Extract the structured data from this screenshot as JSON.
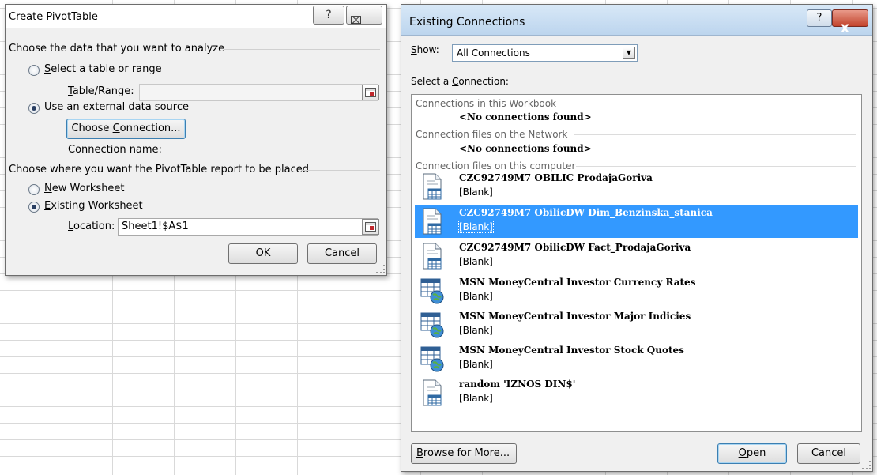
{
  "pivot": {
    "title": "Create PivotTable",
    "help": "?",
    "close": "X",
    "group1": "Choose the data that you want to analyze",
    "opt_range_pre": "",
    "opt_range_u": "S",
    "opt_range_rest": "elect a table or range",
    "table_range_u": "T",
    "table_range_rest": "able/Range:",
    "opt_external_u": "U",
    "opt_external_rest": "se an external data source",
    "choose_conn_pre": "Choose ",
    "choose_conn_u": "C",
    "choose_conn_rest": "onnection...",
    "conn_name_label": "Connection name:",
    "group2": "Choose where you want the PivotTable report to be placed",
    "new_ws_u": "N",
    "new_ws_rest": "ew Worksheet",
    "exist_ws_u": "E",
    "exist_ws_rest": "xisting Worksheet",
    "location_u": "L",
    "location_rest": "ocation:",
    "location_value": "Sheet1!$A$1",
    "ok": "OK",
    "cancel": "Cancel"
  },
  "connections": {
    "title": "Existing Connections",
    "help": "?",
    "close": "X",
    "show_u": "S",
    "show_rest": "how:",
    "show_value": "All Connections",
    "select_pre": "Select a ",
    "select_u": "C",
    "select_rest": "onnection:",
    "sections": {
      "workbook": "Connections in this Workbook",
      "network": "Connection files on the Network",
      "computer": "Connection files on this computer"
    },
    "no_connections": "<No connections found>",
    "items": [
      {
        "name": "CZC92749M7 OBILIC ProdajaGoriva",
        "sub": "[Blank]",
        "icon": "odc-file-icon",
        "selected": false
      },
      {
        "name": "CZC92749M7 ObilicDW Dim_Benzinska_stanica",
        "sub": "[Blank]",
        "icon": "odc-file-icon",
        "selected": true
      },
      {
        "name": "CZC92749M7 ObilicDW Fact_ProdajaGoriva",
        "sub": "[Blank]",
        "icon": "odc-file-icon",
        "selected": false
      },
      {
        "name": "MSN MoneyCentral Investor Currency Rates",
        "sub": "[Blank]",
        "icon": "web-query-icon",
        "selected": false
      },
      {
        "name": "MSN MoneyCentral Investor Major Indicies",
        "sub": "[Blank]",
        "icon": "web-query-icon",
        "selected": false
      },
      {
        "name": "MSN MoneyCentral Investor Stock Quotes",
        "sub": "[Blank]",
        "icon": "web-query-icon",
        "selected": false
      },
      {
        "name": "random 'IZNOS DIN$'",
        "sub": "[Blank]",
        "icon": "odc-file-icon",
        "selected": false
      }
    ],
    "browse_u": "B",
    "browse_rest": "rowse for More...",
    "open_u": "O",
    "open_rest": "pen",
    "cancel": "Cancel"
  }
}
